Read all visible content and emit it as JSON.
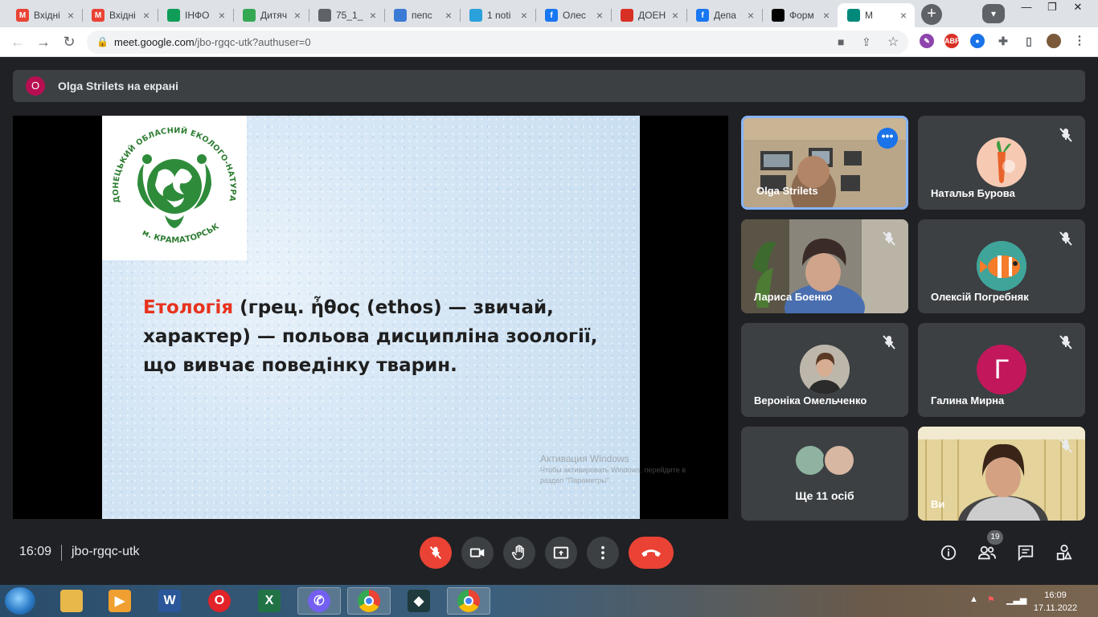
{
  "browser": {
    "tabs": [
      {
        "title": "Вхідні",
        "favicon": "gmail-icon",
        "color": "#ea4335"
      },
      {
        "title": "Вхідні",
        "favicon": "gmail-icon",
        "color": "#ea4335"
      },
      {
        "title": "ІНФО",
        "favicon": "sheets-icon",
        "color": "#0f9d58"
      },
      {
        "title": "Дитяч",
        "favicon": "leaf-icon",
        "color": "#34a853"
      },
      {
        "title": "75_1_",
        "favicon": "link-icon",
        "color": "#5f6368"
      },
      {
        "title": "пепс",
        "favicon": "globe-icon",
        "color": "#3a7bd5"
      },
      {
        "title": "1 noti",
        "favicon": "telegram-icon",
        "color": "#2aa1da"
      },
      {
        "title": "Олес",
        "favicon": "facebook-icon",
        "color": "#1877f2"
      },
      {
        "title": "ДОЕН",
        "favicon": "maps-pin-icon",
        "color": "#d93025"
      },
      {
        "title": "Депа",
        "favicon": "facebook-icon",
        "color": "#1877f2"
      },
      {
        "title": "Форм",
        "favicon": "diia-icon",
        "color": "#000000"
      },
      {
        "title": "М",
        "favicon": "meet-icon",
        "color": "#00897b"
      }
    ],
    "url_host": "meet.google.com",
    "url_path": "/jbo-rgqc-utk?authuser=0"
  },
  "meet": {
    "presenter_initial": "O",
    "presenter_text": "Olga Strilets на екрані",
    "slide": {
      "logo_ring_text": "ДОНЕЦЬКИЙ ОБЛАСНИЙ ЕКОЛОГО-НАТУРАЛІСТИЧНИЙ ЦЕНТР",
      "logo_bottom_text": "м. КРАМАТОРСЬК",
      "term": "Етологія",
      "line1_rest": " (грец. ἦθος (ethos) — звичай,",
      "line2": "характер) — польова дисципліна зоології,",
      "line3": "що вивчає поведінку тварин."
    },
    "watermark": {
      "title": "Активация Windows",
      "subtitle": "Чтобы активировать Windows, перейдите в раздел \"Параметры\"."
    },
    "participants": [
      {
        "name": "Olga Strilets"
      },
      {
        "name": "Наталья Бурова"
      },
      {
        "name": "Лариса Боенко"
      },
      {
        "name": "Олексій Погребняк"
      },
      {
        "name": "Вероніка Омельченко"
      },
      {
        "name": "Галина Мирна",
        "initial": "Г",
        "avatar_color": "#c2185b"
      },
      {
        "name": "Ще 11 осіб"
      },
      {
        "name": "Ви"
      }
    ],
    "time": "16:09",
    "meeting_code": "jbo-rgqc-utk",
    "participant_count": "19"
  },
  "taskbar": {
    "clock_time": "16:09",
    "clock_date": "17.11.2022"
  }
}
